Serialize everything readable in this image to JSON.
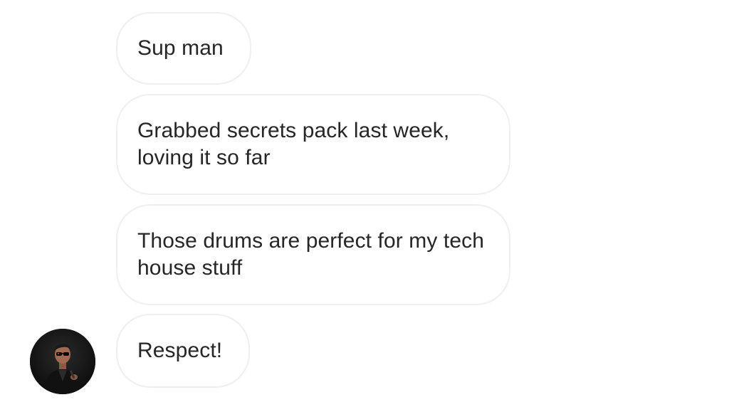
{
  "conversation": {
    "messages": [
      {
        "text": "Sup man"
      },
      {
        "text": "Grabbed secrets pack last week, loving it so far"
      },
      {
        "text": "Those drums are perfect for my tech house stuff"
      },
      {
        "text": "Respect!"
      }
    ],
    "avatar_icon": "user-avatar-photo"
  },
  "colors": {
    "background": "#ffffff",
    "bubble_border": "#efefef",
    "text": "#262626"
  }
}
